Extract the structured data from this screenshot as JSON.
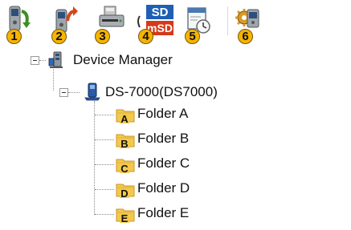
{
  "toolbar": {
    "buttons": [
      {
        "badge": "1",
        "icon": "recorder-download-icon"
      },
      {
        "badge": "2",
        "icon": "recorder-upload-icon"
      },
      {
        "badge": "3",
        "icon": "card-reader-icon"
      },
      {
        "badge": "4",
        "icon": "sd-card-icon",
        "icon_text_top": "SD",
        "icon_text_bottom": "mSD"
      },
      {
        "badge": "5",
        "icon": "clock-settings-icon"
      },
      {
        "badge": "6",
        "icon": "device-settings-icon"
      }
    ],
    "colors": {
      "badge": "#f5b400",
      "sd_top": "#1e5fb4",
      "sd_bottom": "#d33a1a"
    }
  },
  "tree": {
    "root": {
      "label": "Device Manager",
      "icon": "device-manager-icon"
    },
    "device": {
      "label": "DS-7000(DS7000)",
      "icon": "recorder-device-icon"
    },
    "folders": [
      {
        "label": "Folder A",
        "letter": "A"
      },
      {
        "label": "Folder B",
        "letter": "B"
      },
      {
        "label": "Folder C",
        "letter": "C"
      },
      {
        "label": "Folder D",
        "letter": "D"
      },
      {
        "label": "Folder E",
        "letter": "E"
      }
    ],
    "colors": {
      "folder": "#f2c94c",
      "folder_dark": "#c9962a"
    }
  }
}
